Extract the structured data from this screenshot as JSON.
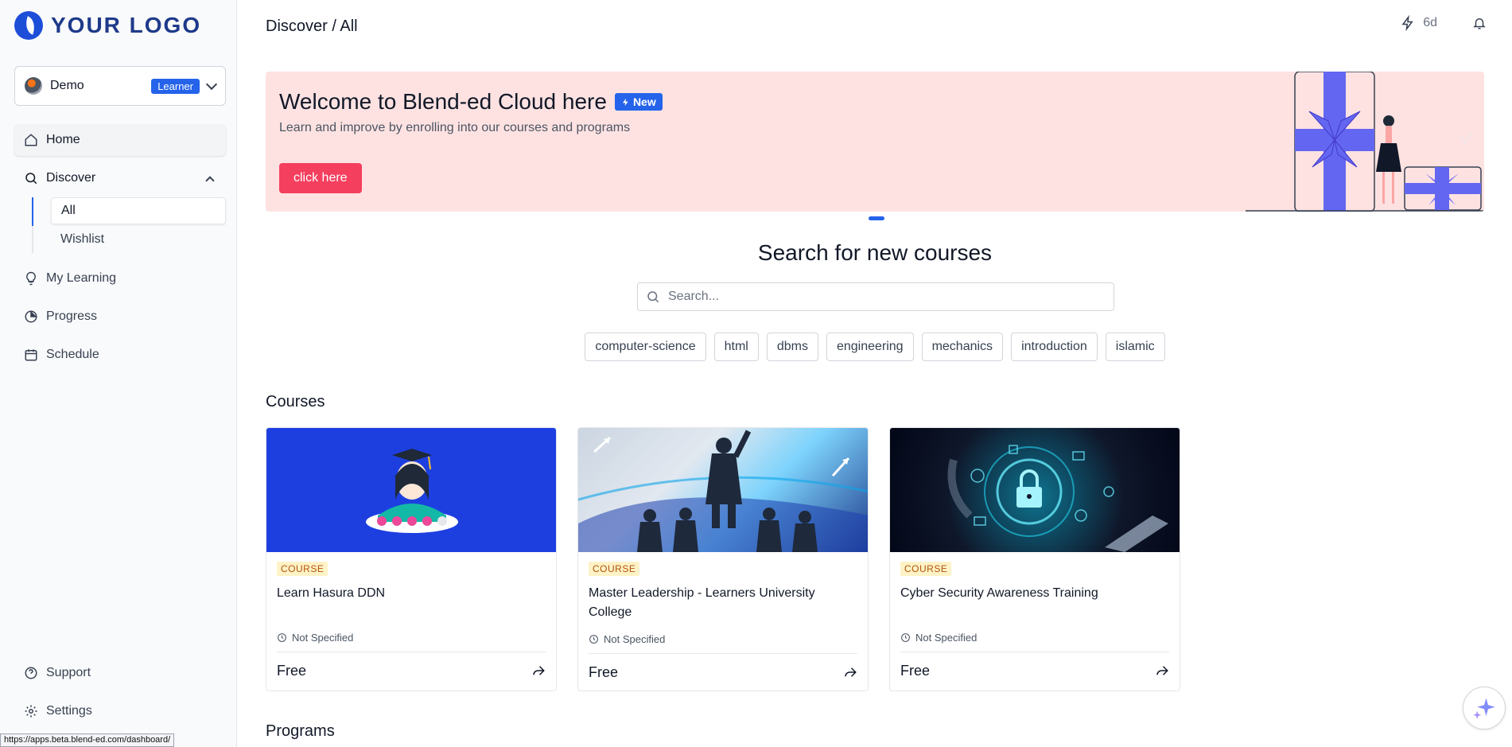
{
  "logo": {
    "text": "YOUR LOGO"
  },
  "user": {
    "name": "Demo",
    "role": "Learner"
  },
  "nav": {
    "home": "Home",
    "discover": "Discover",
    "discover_sub": {
      "all": "All",
      "wishlist": "Wishlist"
    },
    "my_learning": "My Learning",
    "progress": "Progress",
    "schedule": "Schedule",
    "support": "Support",
    "settings": "Settings"
  },
  "status_url": "https://apps.beta.blend-ed.com/dashboard/",
  "header": {
    "breadcrumb": "Discover / All",
    "streak": "6d"
  },
  "banner": {
    "title": "Welcome to Blend-ed Cloud here",
    "badge": "New",
    "subtitle": "Learn and improve by enrolling into our courses and programs",
    "button": "click here"
  },
  "search": {
    "title": "Search for new courses",
    "placeholder": "Search...",
    "tags": [
      "computer-science",
      "html",
      "dbms",
      "engineering",
      "mechanics",
      "introduction",
      "islamic"
    ]
  },
  "courses": {
    "title": "Courses",
    "items": [
      {
        "type": "COURSE",
        "title": "Learn Hasura DDN",
        "duration": "Not Specified",
        "price": "Free"
      },
      {
        "type": "COURSE",
        "title": "Master Leadership - Learners University College",
        "duration": "Not Specified",
        "price": "Free"
      },
      {
        "type": "COURSE",
        "title": "Cyber Security Awareness Training",
        "duration": "Not Specified",
        "price": "Free"
      }
    ]
  },
  "programs": {
    "title": "Programs"
  },
  "colors": {
    "primary": "#2563eb",
    "banner_bg": "#fee2e2",
    "cta": "#f43f5e",
    "badge_bg": "#fef3c7"
  }
}
